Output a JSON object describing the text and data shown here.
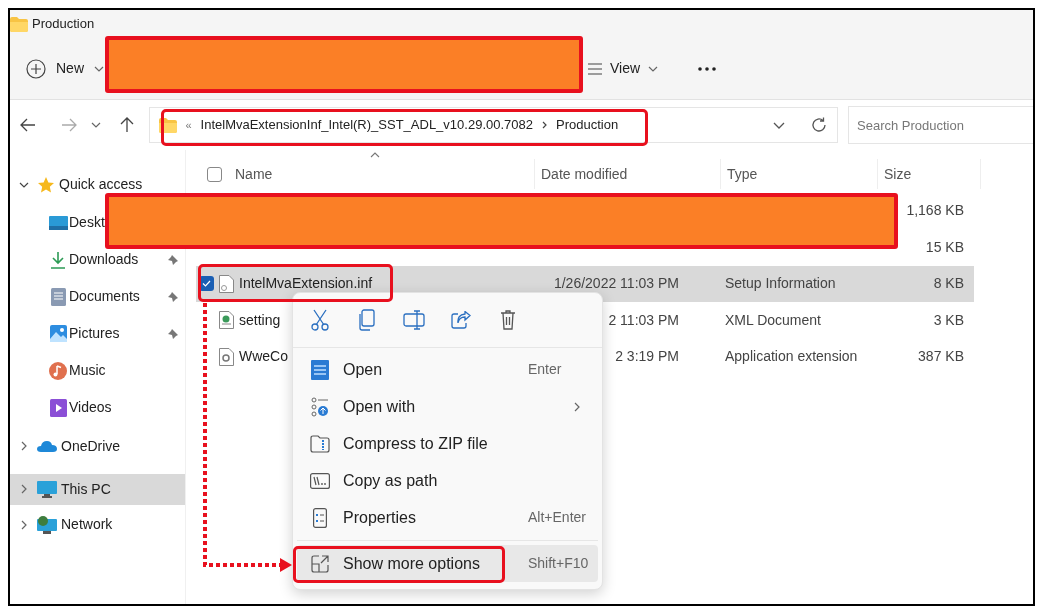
{
  "window": {
    "title": "Production"
  },
  "toolbar": {
    "new_label": "New",
    "view_label": "View"
  },
  "navigation": {
    "back": true,
    "forward": false
  },
  "address": {
    "overflow": "«",
    "segments": [
      "IntelMvaExtensionInf_Intel(R)_SST_ADL_v10.29.00.7082",
      "Production"
    ]
  },
  "search": {
    "placeholder": "Search Production"
  },
  "sidebar": {
    "items": [
      {
        "label": "Quick access",
        "kind": "star",
        "expanded": true,
        "selected": false,
        "children": [
          {
            "label": "Deskt",
            "kind": "desktop",
            "pinned": false,
            "selected": false
          },
          {
            "label": "Downloads",
            "kind": "downloads",
            "pinned": true,
            "selected": false
          },
          {
            "label": "Documents",
            "kind": "documents",
            "pinned": true,
            "selected": false
          },
          {
            "label": "Pictures",
            "kind": "pictures",
            "pinned": true,
            "selected": false
          },
          {
            "label": "Music",
            "kind": "music",
            "pinned": false,
            "selected": false
          },
          {
            "label": "Videos",
            "kind": "videos",
            "pinned": false,
            "selected": false
          }
        ]
      },
      {
        "label": "OneDrive",
        "kind": "cloud",
        "expanded": false,
        "selected": false
      },
      {
        "label": "This PC",
        "kind": "pc",
        "expanded": false,
        "selected": true
      },
      {
        "label": "Network",
        "kind": "network",
        "expanded": false,
        "selected": false
      }
    ]
  },
  "table": {
    "columns": [
      "Name",
      "Date modified",
      "Type",
      "Size"
    ],
    "select_all_checked": false,
    "rows": [
      {
        "size": "1,168 KB",
        "selected": false
      },
      {
        "size": "15 KB",
        "selected": false
      },
      {
        "name": "IntelMvaExtension.inf",
        "kind": "inf",
        "date": "1/26/2022 11:03 PM",
        "type": "Setup Information",
        "size": "8 KB",
        "selected": true,
        "checked": true
      },
      {
        "name": "setting",
        "kind": "xml",
        "date": "2 11:03 PM",
        "type": "XML Document",
        "size": "3 KB",
        "selected": false,
        "checked": false
      },
      {
        "name": "WweCo",
        "kind": "dll",
        "date": "2 3:19 PM",
        "type": "Application extension",
        "size": "387 KB",
        "selected": false,
        "checked": false
      }
    ]
  },
  "context_menu": {
    "actions": [
      {
        "kind": "cut"
      },
      {
        "kind": "copy"
      },
      {
        "kind": "rename"
      },
      {
        "kind": "share"
      },
      {
        "kind": "delete"
      }
    ],
    "items": [
      {
        "kind": "open",
        "label": "Open",
        "shortcut": "Enter",
        "submenu": false,
        "highlighted": false
      },
      {
        "kind": "open_with",
        "label": "Open with",
        "submenu": true,
        "highlighted": false
      },
      {
        "kind": "zip",
        "label": "Compress to ZIP file",
        "submenu": false,
        "highlighted": false
      },
      {
        "kind": "path",
        "label": "Copy as path",
        "submenu": false,
        "highlighted": false
      },
      {
        "kind": "properties",
        "label": "Properties",
        "shortcut": "Alt+Enter",
        "submenu": false,
        "highlighted": false
      },
      {
        "kind": "more",
        "label": "Show more options",
        "shortcut": "Shift+F10",
        "submenu": false,
        "highlighted": true,
        "separated": true
      }
    ]
  }
}
